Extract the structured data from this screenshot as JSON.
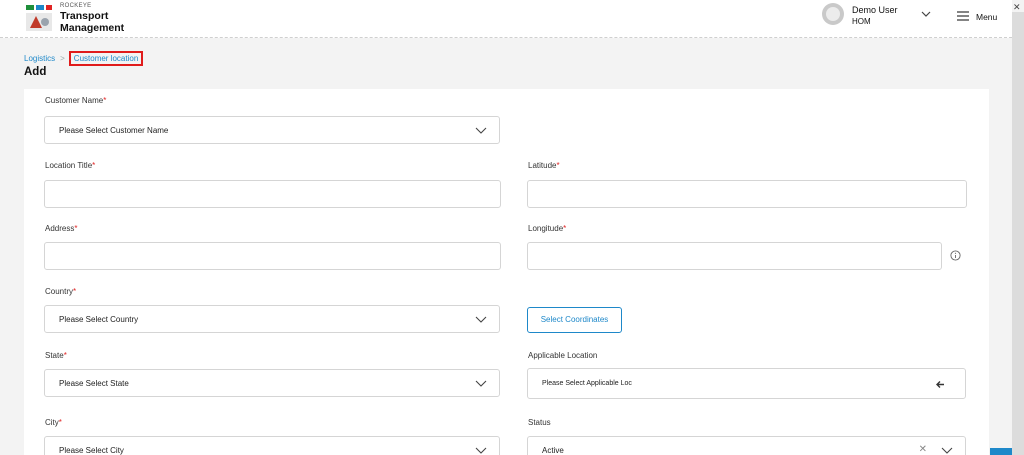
{
  "header": {
    "brand_small": "ROCKEYE",
    "brand_line1": "Transport",
    "brand_line2": "Management",
    "user_name": "Demo User",
    "user_role": "HOM",
    "menu_label": "Menu"
  },
  "breadcrumb": {
    "root": "Logistics",
    "separator": ">",
    "current": "Customer location"
  },
  "page": {
    "title": "Add"
  },
  "form": {
    "customer_name": {
      "label": "Customer Name",
      "required": "*",
      "value": "Please Select Customer Name"
    },
    "location_title": {
      "label": "Location Title",
      "required": "*",
      "value": ""
    },
    "latitude": {
      "label": "Latitude",
      "required": "*",
      "value": ""
    },
    "address": {
      "label": "Address",
      "required": "*",
      "value": ""
    },
    "longitude": {
      "label": "Longitude",
      "required": "*",
      "value": ""
    },
    "country": {
      "label": "Country",
      "required": "*",
      "value": "Please Select Country"
    },
    "select_coordinates": "Select Coordinates",
    "state": {
      "label": "State",
      "required": "*",
      "value": "Please Select State"
    },
    "applicable_location": {
      "label": "Applicable Location",
      "value": "Please Select Applicable Loc"
    },
    "city": {
      "label": "City",
      "required": "*",
      "value": "Please Select City"
    },
    "status": {
      "label": "Status",
      "value": "Active"
    }
  },
  "colors": {
    "accent": "#1e88c9",
    "required": "#e02424",
    "highlight_border": "#e01b1b"
  },
  "icons": [
    "logo-icon",
    "avatar-icon",
    "chevron-down-icon",
    "menu-icon",
    "close-icon",
    "info-icon",
    "arrow-left-icon",
    "clear-icon"
  ]
}
